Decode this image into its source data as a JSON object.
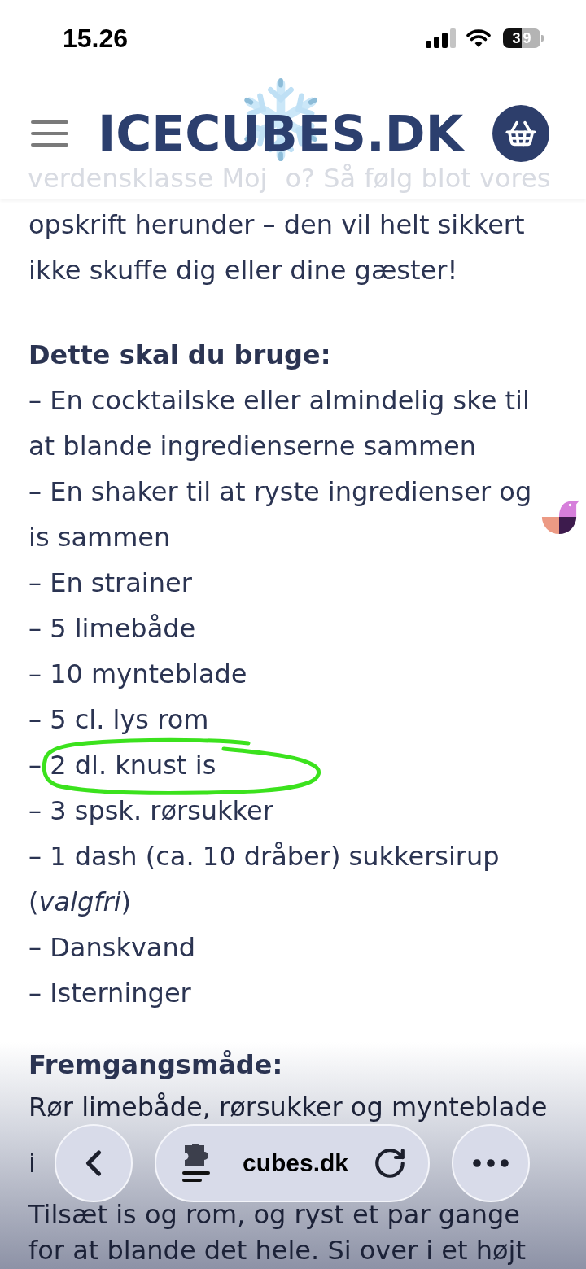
{
  "status_bar": {
    "time": "15.26",
    "battery": "39"
  },
  "header": {
    "logo": "ICECUBES.DK"
  },
  "faded_text": [
    "verdensklasse Moj",
    "o? Så følg blot vores"
  ],
  "intro": "opskrift herunder – den vil helt sikkert ikke skuffe dig eller dine gæster!",
  "ingredients": {
    "heading": "Dette skal du bruge:",
    "items": [
      "– En cocktailske eller almindelig ske til at blande ingredienserne sammen",
      "– En shaker til at ryste ingredienser og is sammen",
      "– En strainer",
      "– 5 limebåde",
      "– 10 mynteblade",
      "– 5 cl. lys rom",
      "– 2 dl. knust is",
      "– 3 spsk. rørsukker",
      "– 1 dash (ca. 10 dråber) sukkersirup (*valgfri*)",
      "– Danskvand",
      "– Isterninger"
    ]
  },
  "method": {
    "heading": "Fremgangsmåde:",
    "lines": [
      "Rør limebåde, rørsukker og mynteblade",
      "i",
      "Tilsæt is og rom, og ryst et par gange",
      "for at blande det hele. Si over i et højt"
    ]
  },
  "browser_bar": {
    "url": "cubes.dk"
  }
}
